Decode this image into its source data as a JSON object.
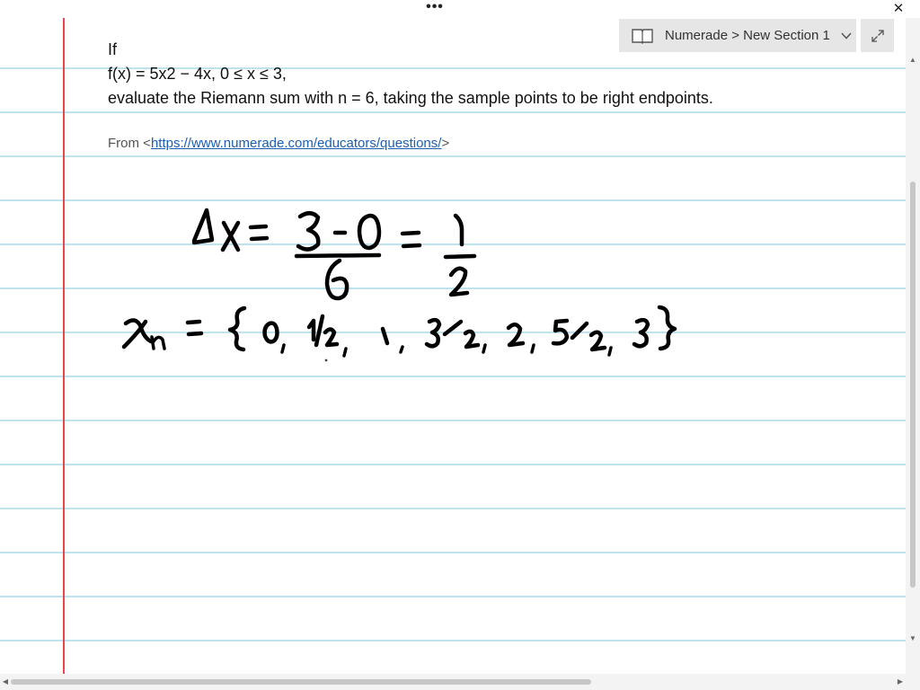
{
  "window": {
    "menu_dots": "•••",
    "close_glyph": "✕"
  },
  "notebook": {
    "breadcrumb": "Numerade > New Section 1",
    "icons": [
      "notebook-icon",
      "chevron-down-icon",
      "expand-icon"
    ]
  },
  "note": {
    "lines": [
      "If",
      "f(x) = 5x2 − 4x, 0 ≤ x ≤ 3,",
      "evaluate the Riemann sum with n = 6, taking the sample points to be right endpoints."
    ],
    "source_prefix": "From <",
    "source_link": "https://www.numerade.com/educators/questions/",
    "source_suffix": ">"
  },
  "handwriting": {
    "line1": "Δx = (3 - 0)/6 = 1/2",
    "line2": "xn = { 0, 1/2, 1, 3/2, 2, 5/2, 3 }"
  },
  "colors": {
    "margin_line": "#e8474f",
    "rule_line": "#bfe3ee",
    "link": "#1a5fb4"
  }
}
